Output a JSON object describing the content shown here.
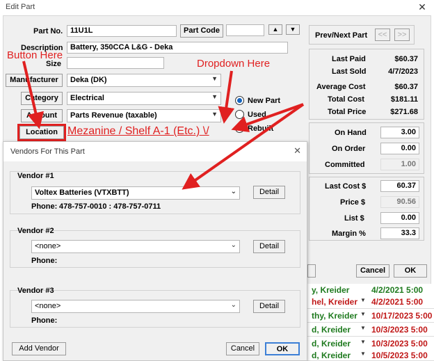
{
  "window": {
    "title": "Edit Part",
    "close": "✕"
  },
  "part": {
    "part_no_label": "Part No.",
    "part_no": "11U1L",
    "part_code_btn": "Part Code",
    "part_code_value": "",
    "description_label": "Description",
    "description": "Battery, 350CCA L&G - Deka",
    "size_label": "Size",
    "size": "",
    "manufacturer_btn": "Manufacturer",
    "manufacturer": "Deka (DK)",
    "category_btn": "Category",
    "category": "Electrical",
    "account_btn": "Account",
    "account": "Parts Revenue (taxable)",
    "location_btn": "Location"
  },
  "radios": [
    {
      "label": "New Part",
      "selected": true
    },
    {
      "label": "Used",
      "selected": false
    },
    {
      "label": "Rebuilt",
      "selected": false
    }
  ],
  "nav": {
    "label": "Prev/Next Part",
    "prev": "<<",
    "next": ">>"
  },
  "stats": [
    {
      "label": "Last Paid",
      "value": "$60.37"
    },
    {
      "label": "Last Sold",
      "value": "4/7/2023"
    },
    {
      "label": "Average Cost",
      "value": "$60.37"
    },
    {
      "label": "Total Cost",
      "value": "$181.11"
    },
    {
      "label": "Total Price",
      "value": "$271.68"
    }
  ],
  "stock": [
    {
      "label": "On Hand",
      "value": "3.00"
    },
    {
      "label": "On Order",
      "value": "0.00"
    },
    {
      "label": "Committed",
      "value": "1.00"
    }
  ],
  "pricing": [
    {
      "label": "Last Cost $",
      "value": "60.37"
    },
    {
      "label": "Price $",
      "value": "90.56"
    },
    {
      "label": "List $",
      "value": "0.00"
    },
    {
      "label": "Margin %",
      "value": "33.3"
    }
  ],
  "main_buttons": {
    "cancel": "Cancel",
    "ok": "OK"
  },
  "vendors_dialog": {
    "title": "Vendors For This Part",
    "close": "✕",
    "vendors": [
      {
        "heading": "Vendor #1",
        "selected": "Voltex Batteries (VTXBTT)",
        "phone_label": "Phone:",
        "phone": "478-757-0010 : 478-757-0711",
        "detail": "Detail"
      },
      {
        "heading": "Vendor #2",
        "selected": "<none>",
        "phone_label": "Phone:",
        "phone": "",
        "detail": "Detail"
      },
      {
        "heading": "Vendor #3",
        "selected": "<none>",
        "phone_label": "Phone:",
        "phone": "",
        "detail": "Detail"
      }
    ],
    "add_vendor": "Add Vendor",
    "cancel": "Cancel",
    "ok": "OK"
  },
  "background_rows": [
    {
      "name": "y, Kreider",
      "date": "4/2/2021 5:00",
      "color": "#1e7a1e"
    },
    {
      "name": "hel, Kreider",
      "date": "4/2/2021 5:00",
      "color": "#c01818"
    },
    {
      "name": "thy, Kreider",
      "date": "10/17/2023 5:00",
      "color": "#1e7a1e"
    },
    {
      "name": "d, Kreider",
      "date": "10/3/2023 5:00",
      "color": "#1e7a1e"
    },
    {
      "name": "d, Kreider",
      "date": "10/3/2023 5:00",
      "color": "#c01818"
    },
    {
      "name": "d, Kreider",
      "date": "10/5/2023 5:00",
      "color": "#c01818"
    }
  ],
  "annotations": {
    "button_here": "Button Here",
    "dropdown_here": "Dropdown Here",
    "mezzanine": "Mezanine / Shelf A-1 (Etc.) \\/",
    "color": "#e02020"
  }
}
